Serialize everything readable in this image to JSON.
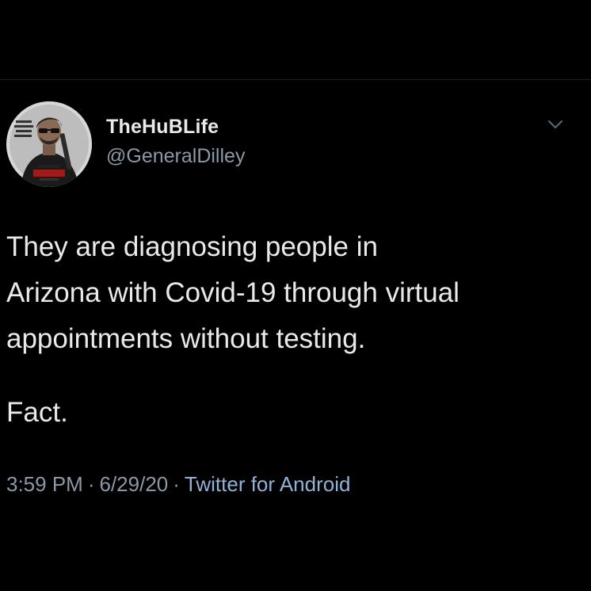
{
  "tweet": {
    "display_name": "TheHuBLife",
    "handle": "@GeneralDilley",
    "text_lines": [
      "They are diagnosing people in",
      "Arizona with Covid-19 through virtual",
      "appointments without testing."
    ],
    "closing_line": "Fact.",
    "time": "3:59 PM",
    "date": "6/29/20",
    "separator": "·",
    "source": "Twitter for Android",
    "menu_icon": "chevron-down-icon"
  },
  "colors": {
    "background": "#000000",
    "primary_text": "#e7e9ea",
    "secondary_text": "#8b98a5",
    "source_link": "#8fb3d8"
  }
}
